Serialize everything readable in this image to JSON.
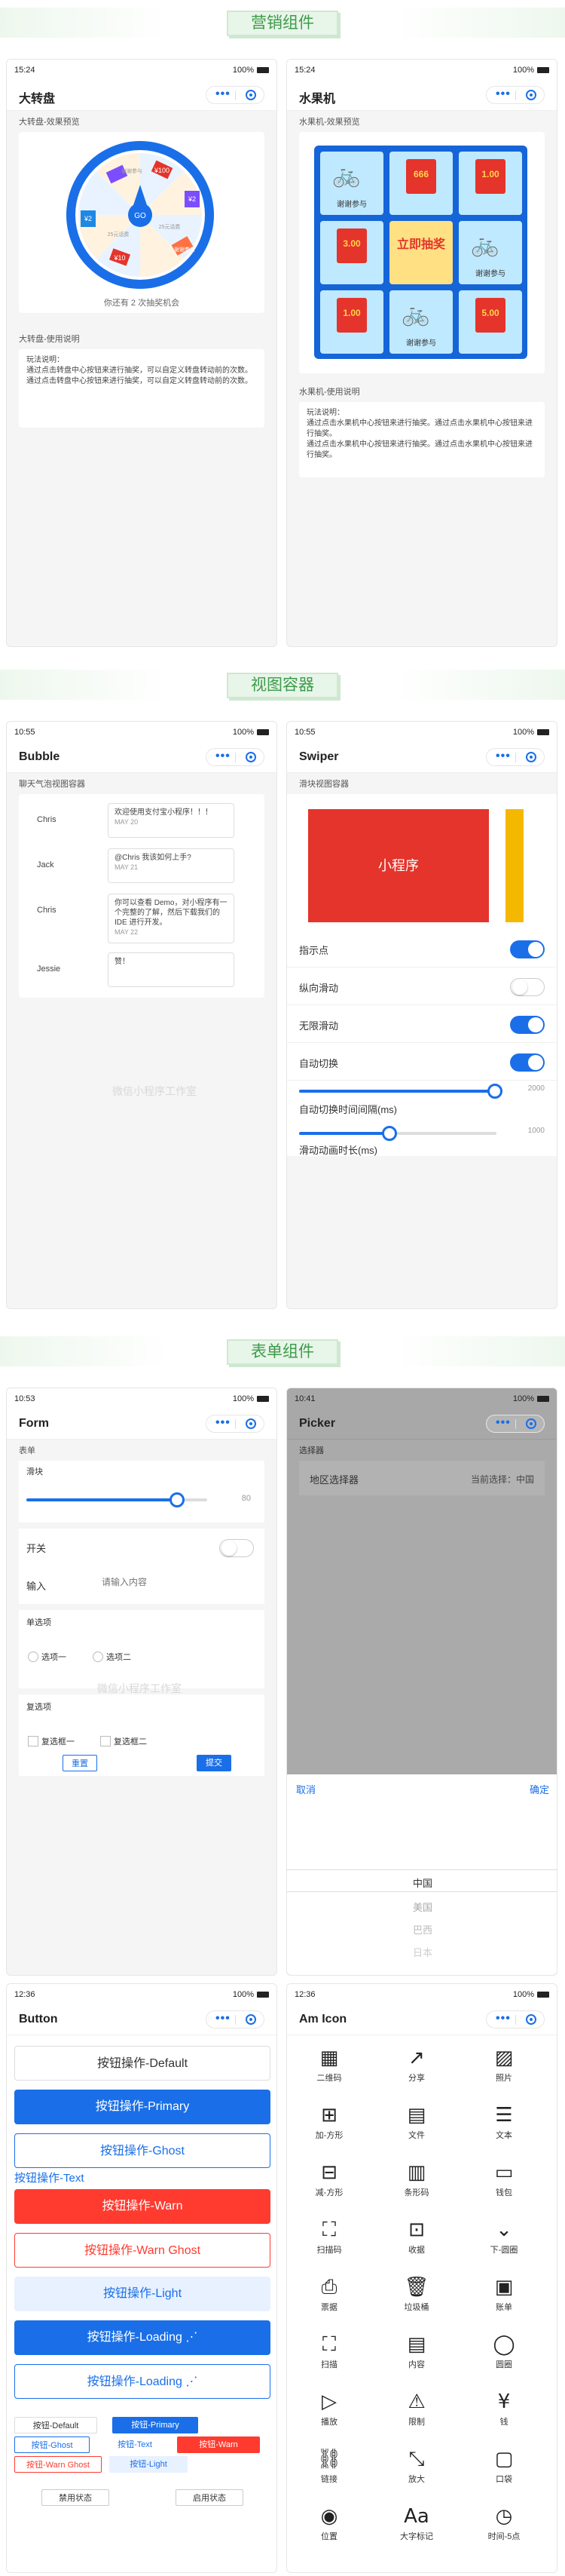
{
  "sections": [
    "营销组件",
    "视图容器",
    "表单组件"
  ],
  "status": {
    "t1": "15:24",
    "t2": "10:55",
    "t3": "10:53",
    "t4": "10:41",
    "t5": "12:36",
    "battery": "100%"
  },
  "wheel": {
    "title": "大转盘",
    "preview_label": "大转盘-效果预览",
    "go": "GO",
    "prizes": [
      "¥100",
      "谢谢参与",
      "¥2",
      "25元话费",
      "¥10",
      "谢谢参与",
      "¥2",
      "25元话费"
    ],
    "footer": "你还有 2 次抽奖机会",
    "usage_label": "大转盘-使用说明",
    "usage": "玩法说明：\n通过点击转盘中心按钮来进行抽奖，可以自定义转盘转动前的次数。\n通过点击转盘中心按钮来进行抽奖，可以自定义转盘转动前的次数。"
  },
  "slot": {
    "title": "水果机",
    "preview_label": "水果机-效果预览",
    "cells": [
      "谢谢参与",
      "666",
      "1.00",
      "3.00",
      "立即抽奖",
      "谢谢参与",
      "1.00",
      "谢谢参与",
      "5.00"
    ],
    "usage_label": "水果机-使用说明",
    "usage": "玩法说明：\n通过点击水果机中心按钮来进行抽奖。通过点击水果机中心按钮来进行抽奖。\n通过点击水果机中心按钮来进行抽奖。通过点击水果机中心按钮来进行抽奖。"
  },
  "bubble": {
    "title": "Bubble",
    "label": "聊天气泡视图容器",
    "rows": [
      {
        "name": "Chris",
        "msg": "欢迎使用支付宝小程序！！！",
        "date": "MAY 20"
      },
      {
        "name": "Jack",
        "msg": "@Chris 我该如何上手?",
        "date": "MAY 21"
      },
      {
        "name": "Chris",
        "msg": "你可以查看 Demo，对小程序有一个完整的了解，然后下载我们的 IDE 进行开发。",
        "date": "MAY 22"
      },
      {
        "name": "Jessie",
        "msg": "赞！",
        "date": ""
      }
    ]
  },
  "swiper": {
    "title": "Swiper",
    "label": "滑块视图容器",
    "slide": "小程序",
    "rows": [
      {
        "k": "指示点",
        "on": true
      },
      {
        "k": "纵向滑动",
        "on": false
      },
      {
        "k": "无限滑动",
        "on": true
      },
      {
        "k": "自动切换",
        "on": true
      }
    ],
    "interval_label": "自动切换时间间隔(ms)",
    "interval": "2000",
    "duration_label": "滑动动画时长(ms)",
    "duration": "1000"
  },
  "form": {
    "title": "Form",
    "label": "表单",
    "slider_label": "滑块",
    "slider_value": "80",
    "switch": "开关",
    "input": "输入",
    "input_ph": "请输入内容",
    "radio_label": "单选项",
    "radios": [
      "选项一",
      "选项二"
    ],
    "check_label": "复选项",
    "checks": [
      "复选框一",
      "复选框二"
    ],
    "reset": "重置",
    "submit": "提交"
  },
  "picker": {
    "title": "Picker",
    "label": "选择器",
    "row": "地区选择器",
    "current": "当前选择：中国",
    "cancel": "取消",
    "ok": "确定",
    "options": [
      "中国",
      "美国",
      "巴西",
      "日本"
    ]
  },
  "button": {
    "title": "Button",
    "items": [
      "按钮操作-Default",
      "按钮操作-Primary",
      "按钮操作-Ghost",
      "按钮操作-Text",
      "按钮操作-Warn",
      "按钮操作-Warn Ghost",
      "按钮操作-Light",
      "按钮操作-Loading",
      "按钮操作-Loading"
    ],
    "small": [
      "按钮-Default",
      "按钮-Primary",
      "按钮-Ghost",
      "按钮-Text",
      "按钮-Warn",
      "按钮-Warn Ghost",
      "按钮-Light"
    ],
    "disabled": "禁用状态",
    "enabled": "启用状态"
  },
  "amicon": {
    "title": "Am Icon",
    "icons": [
      [
        "▦",
        "二维码"
      ],
      [
        "↗",
        "分享"
      ],
      [
        "▨",
        "照片"
      ],
      [
        "⊞",
        "加-方形"
      ],
      [
        "▤",
        "文件"
      ],
      [
        "☰",
        "文本"
      ],
      [
        "⊟",
        "减-方形"
      ],
      [
        "▥",
        "条形码"
      ],
      [
        "▭",
        "钱包"
      ],
      [
        "⛶",
        "扫描码"
      ],
      [
        "⊡",
        "收据"
      ],
      [
        "⌄",
        "下-圆圈"
      ],
      [
        "⎙",
        "票据"
      ],
      [
        "🗑",
        "垃圾桶"
      ],
      [
        "▣",
        "账单"
      ],
      [
        "⛶",
        "扫描"
      ],
      [
        "▤",
        "内容"
      ],
      [
        "◯",
        "圆圈"
      ],
      [
        "▷",
        "播放"
      ],
      [
        "⚠",
        "限制"
      ],
      [
        "¥",
        "钱"
      ],
      [
        "⛓",
        "链接"
      ],
      [
        "⤡",
        "放大"
      ],
      [
        "▢",
        "口袋"
      ],
      [
        "◉",
        "位置"
      ],
      [
        "Aa",
        "大字标记"
      ],
      [
        "◷",
        "时间-5点"
      ]
    ]
  },
  "watermark": "微信小程序工作室"
}
